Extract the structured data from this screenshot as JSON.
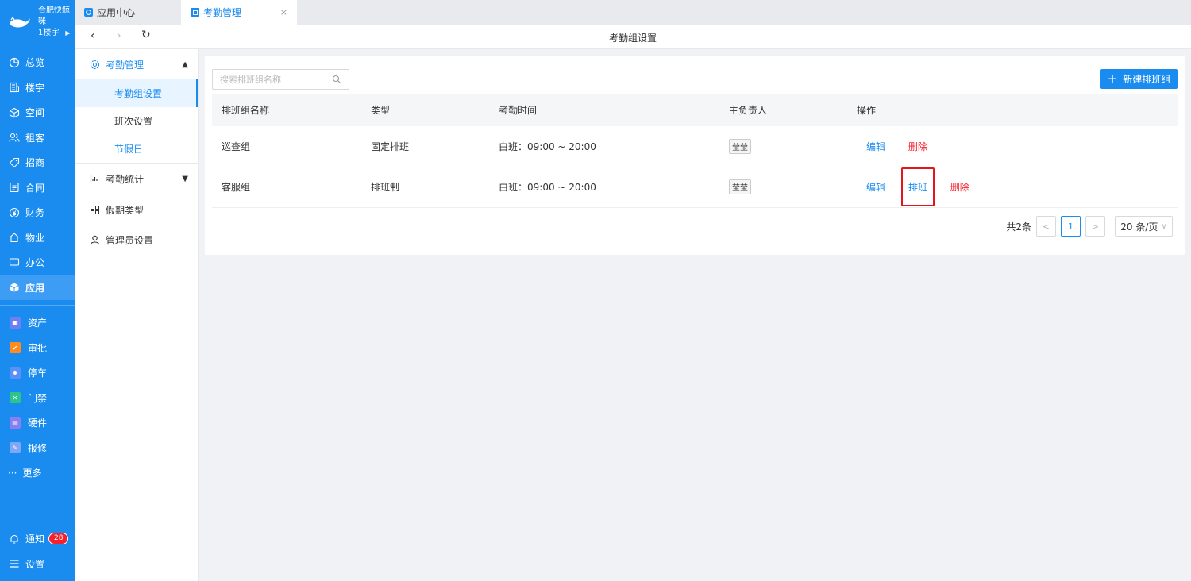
{
  "brand": {
    "name": "合肥快鲸咪",
    "building": "1楼宇"
  },
  "nav": [
    {
      "label": "总览",
      "icon": "dashboard-icon"
    },
    {
      "label": "楼宇",
      "icon": "building-icon"
    },
    {
      "label": "空间",
      "icon": "cube-icon"
    },
    {
      "label": "租客",
      "icon": "tenant-icon"
    },
    {
      "label": "招商",
      "icon": "tag-icon"
    },
    {
      "label": "合同",
      "icon": "contract-icon"
    },
    {
      "label": "财务",
      "icon": "finance-icon"
    },
    {
      "label": "物业",
      "icon": "home-icon"
    },
    {
      "label": "办公",
      "icon": "monitor-icon"
    },
    {
      "label": "应用",
      "icon": "app-icon"
    }
  ],
  "apps": [
    {
      "label": "资产",
      "color": "#6e7ff3"
    },
    {
      "label": "审批",
      "color": "#ff8a1f"
    },
    {
      "label": "停车",
      "color": "#5b8ff9"
    },
    {
      "label": "门禁",
      "color": "#2bc48b"
    },
    {
      "label": "硬件",
      "color": "#8a7ff0"
    },
    {
      "label": "报修",
      "color": "#7fa6f7"
    }
  ],
  "more_label": "更多",
  "notify": {
    "label": "通知",
    "count": "28"
  },
  "settings_label": "设置",
  "tabs": [
    {
      "label": "应用中心"
    },
    {
      "label": "考勤管理",
      "close": "×"
    }
  ],
  "toolbar": {
    "title": "考勤组设置",
    "back": "‹",
    "forward": "›",
    "refresh": "↻"
  },
  "submenu": {
    "group1": "考勤管理",
    "items": [
      "考勤组设置",
      "班次设置",
      "节假日"
    ],
    "group2": "考勤统计",
    "group3": "假期类型",
    "group4": "管理员设置"
  },
  "search": {
    "placeholder": "搜索排班组名称"
  },
  "new_button": "新建排班组",
  "table": {
    "headers": [
      "排班组名称",
      "类型",
      "考勤时间",
      "主负责人",
      "操作"
    ],
    "rows": [
      {
        "name": "巡查组",
        "type": "固定排班",
        "time": "白班：09:00 ~ 20:00",
        "owner": "莹莹",
        "ops": [
          "编辑",
          "删除"
        ]
      },
      {
        "name": "客服组",
        "type": "排班制",
        "time": "白班：09:00 ~ 20:00",
        "owner": "莹莹",
        "ops": [
          "编辑",
          "排班",
          "删除"
        ]
      }
    ]
  },
  "pagination": {
    "total": "共2条",
    "current": "1",
    "page_size": "20 条/页"
  }
}
